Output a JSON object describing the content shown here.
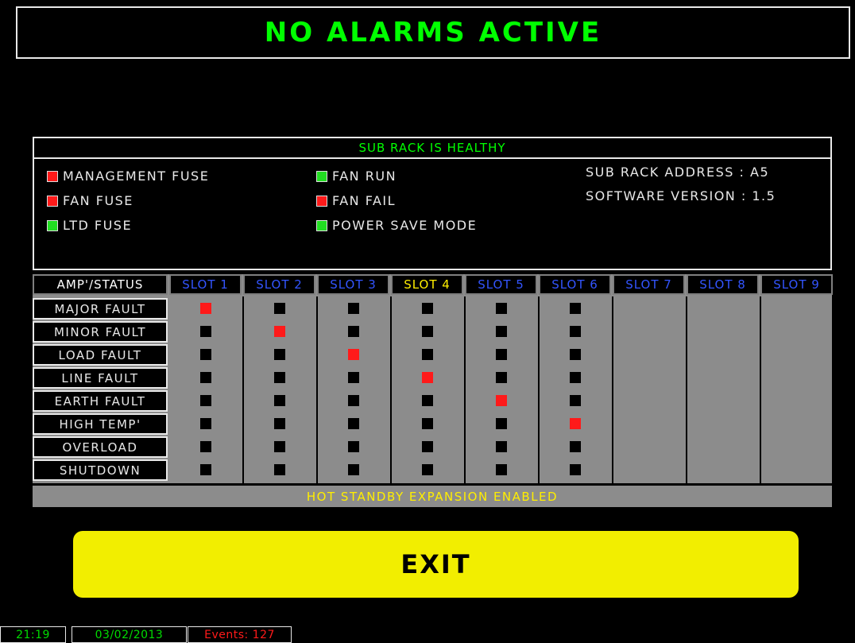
{
  "header": {
    "title": "NO ALARMS ACTIVE",
    "title_color": "#00ff00"
  },
  "panel": {
    "status_text": "SUB RACK IS HEALTHY",
    "status_color": "#00ff00",
    "indicators": [
      {
        "label": "MANAGEMENT FUSE",
        "state": "red"
      },
      {
        "label": "FAN FUSE",
        "state": "red"
      },
      {
        "label": "LTD FUSE",
        "state": "green"
      },
      {
        "label": "FAN RUN",
        "state": "green"
      },
      {
        "label": "FAN FAIL",
        "state": "red"
      },
      {
        "label": "POWER SAVE MODE",
        "state": "green"
      }
    ],
    "address_label": "SUB RACK ADDRESS : A5",
    "version_label": "SOFTWARE VERSION : 1.5"
  },
  "grid": {
    "corner_label": "AMP'/STATUS",
    "slots": [
      "SLOT 1",
      "SLOT 2",
      "SLOT 3",
      "SLOT 4",
      "SLOT 5",
      "SLOT 6",
      "SLOT 7",
      "SLOT 8",
      "SLOT 9"
    ],
    "highlighted_slot": 3,
    "rows": [
      "MAJOR FAULT",
      "MINOR FAULT",
      "LOAD FAULT",
      "LINE FAULT",
      "EARTH FAULT",
      "HIGH TEMP'",
      "OVERLOAD",
      "SHUTDOWN"
    ],
    "populated_slots": 6,
    "active_faults": [
      [
        0,
        0
      ],
      [
        1,
        1
      ],
      [
        2,
        2
      ],
      [
        3,
        3
      ],
      [
        4,
        4
      ],
      [
        5,
        5
      ]
    ],
    "footer_text": "HOT STANDBY EXPANSION ENABLED"
  },
  "exit_button": {
    "label": "EXIT"
  },
  "status_bar": {
    "time": "21:19",
    "date": "03/02/2013",
    "events": "Events: 127"
  },
  "colors": {
    "led_red": "#ff1a1a",
    "led_green": "#22dd22",
    "slot_header": "#3355ff",
    "slot_highlight": "#ffee00",
    "footer_text": "#ffee00",
    "exit_bg": "#f2ee00",
    "status_green": "#00dd00",
    "status_red": "#ff1a1a"
  }
}
